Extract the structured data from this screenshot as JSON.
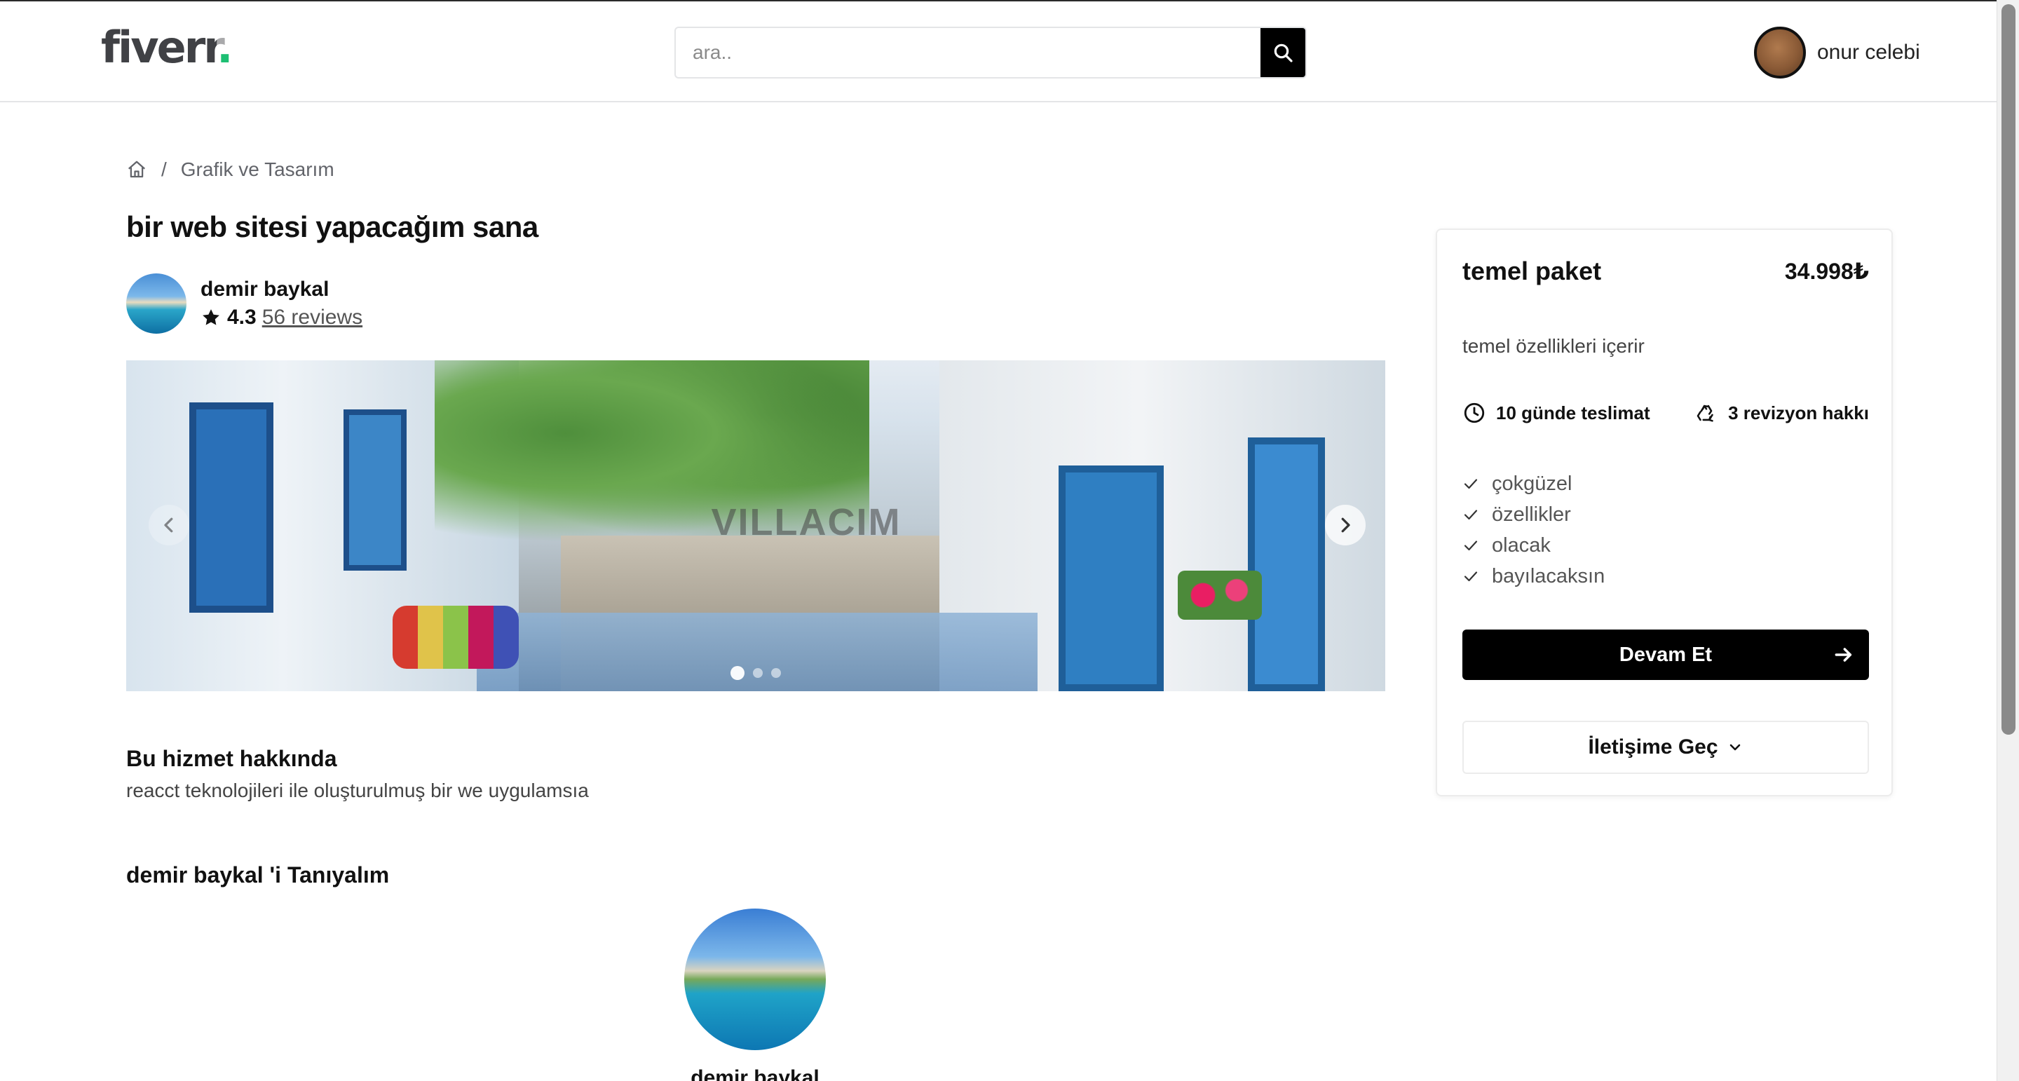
{
  "header": {
    "logo_text": "fiverr",
    "logo_dot": ".",
    "search_placeholder": "ara..",
    "user_name": "onur celebi"
  },
  "breadcrumb": {
    "separator": "/",
    "category": "Grafik ve Tasarım"
  },
  "gig": {
    "title": "bir web sitesi yapacağım sana",
    "seller_name": "demir baykal",
    "rating": "4.3",
    "reviews": "56 reviews",
    "slider": {
      "watermark": "VILLACIM",
      "slide_count": 3,
      "active_slide": 1
    },
    "about_title": "Bu hizmet hakkında",
    "about_text": "reacct teknolojileri ile oluşturulmuş bir we uygulamsıa",
    "meet_title": "demir baykal 'i Tanıyalım",
    "meet_name": "demir baykal"
  },
  "package": {
    "title": "temel paket",
    "price": "34.998₺",
    "description": "temel özellikleri içerir",
    "delivery": "10 günde teslimat",
    "revisions": "3 revizyon hakkı",
    "features": [
      "çokgüzel",
      "özellikler",
      "olacak",
      "bayılacaksın"
    ],
    "continue_label": "Devam Et",
    "contact_label": "İletişime Geç"
  },
  "colors": {
    "brand_green": "#1dbf73",
    "button_black": "#000000"
  }
}
